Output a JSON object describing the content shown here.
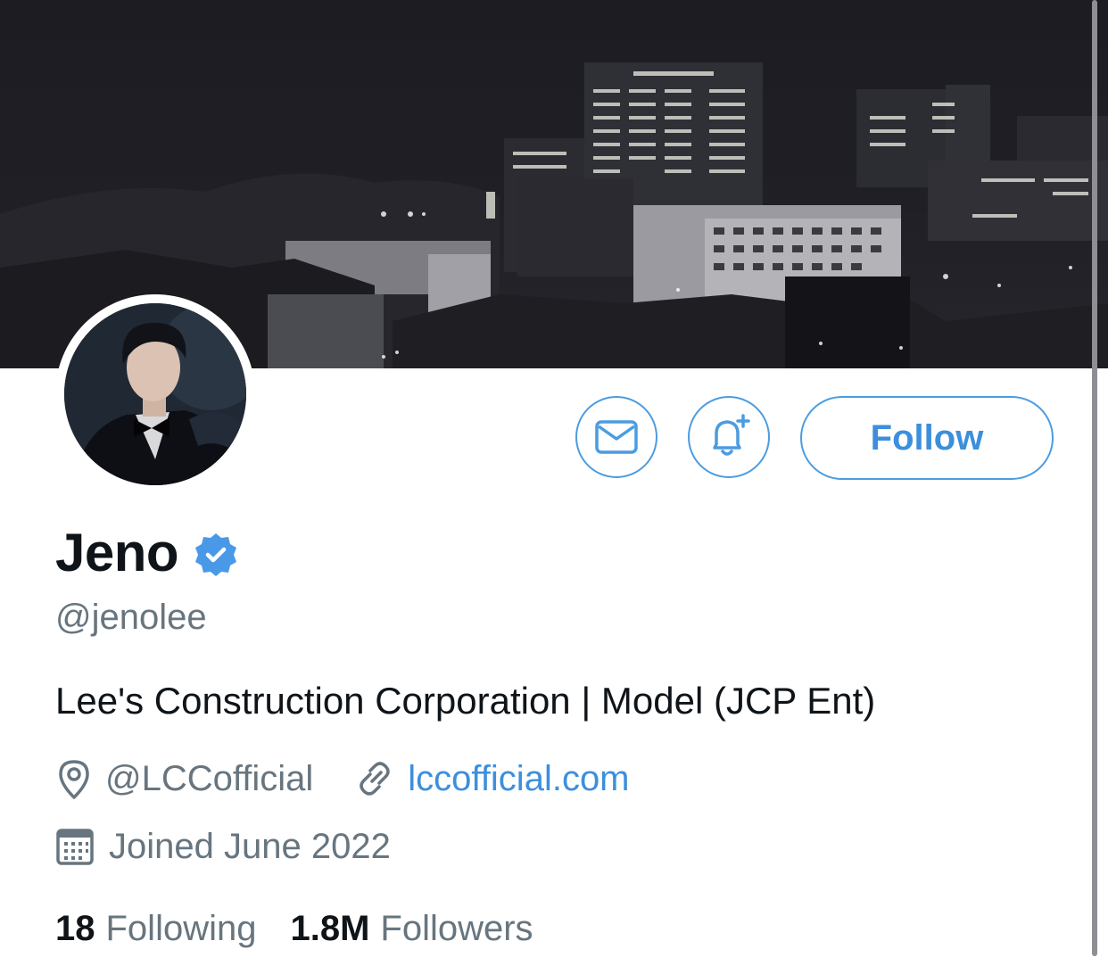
{
  "profile": {
    "name": "Jeno",
    "handle": "@jenolee",
    "bio": "Lee's Construction Corporation | Model (JCP Ent)",
    "location": "@LCCofficial",
    "website": "lccofficial.com",
    "joined": "Joined June 2022",
    "verified": true
  },
  "actions": {
    "follow_label": "Follow",
    "message_icon": "envelope-icon",
    "notify_icon": "bell-plus-icon"
  },
  "stats": {
    "following_count": "18",
    "following_label": "Following",
    "followers_count": "1.8M",
    "followers_label": "Followers"
  },
  "colors": {
    "accent": "#4b9ce0",
    "link": "#3d8fdc",
    "text_primary": "#0f1419",
    "text_secondary": "#67757f",
    "verified_badge": "#4a99e9"
  }
}
